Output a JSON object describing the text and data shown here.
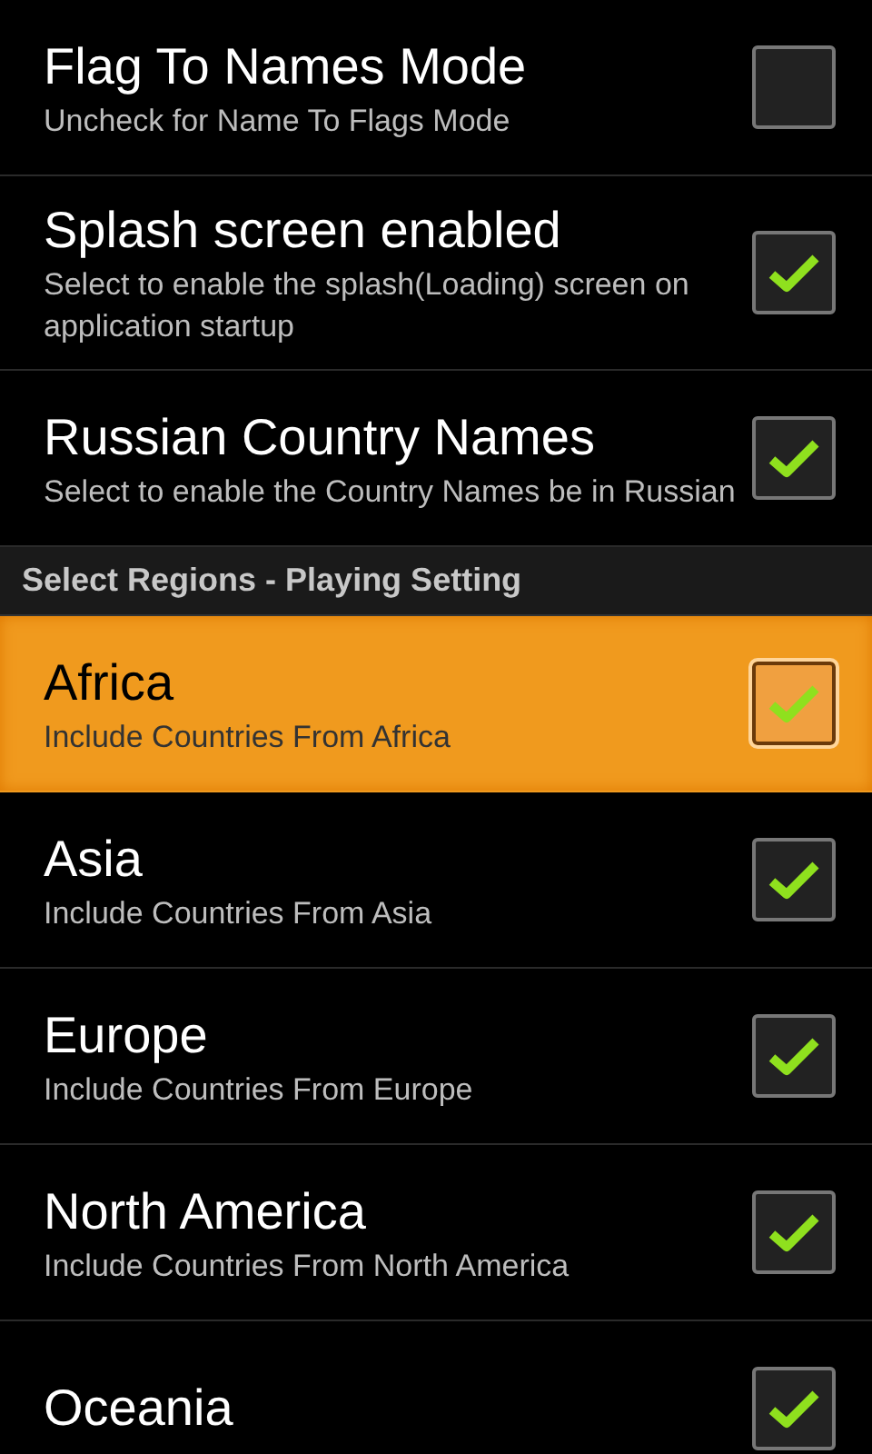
{
  "items": [
    {
      "kind": "pref",
      "title": "Flag To Names Mode",
      "summary": "Uncheck for Name To Flags Mode",
      "checked": false,
      "selected": false
    },
    {
      "kind": "pref",
      "title": "Splash screen enabled",
      "summary": "Select to enable the splash(Loading) screen on application startup",
      "checked": true,
      "selected": false
    },
    {
      "kind": "pref",
      "title": "Russian Country Names",
      "summary": "Select to enable the Country Names be in Russian",
      "checked": true,
      "selected": false
    },
    {
      "kind": "category",
      "title": "Select Regions - Playing Setting"
    },
    {
      "kind": "pref",
      "title": "Africa",
      "summary": "Include Countries From Africa",
      "checked": true,
      "selected": true
    },
    {
      "kind": "pref",
      "title": "Asia",
      "summary": "Include Countries From Asia",
      "checked": true,
      "selected": false
    },
    {
      "kind": "pref",
      "title": "Europe",
      "summary": "Include Countries From Europe",
      "checked": true,
      "selected": false
    },
    {
      "kind": "pref",
      "title": "North America",
      "summary": "Include Countries From North America",
      "checked": true,
      "selected": false
    },
    {
      "kind": "pref",
      "title": "Oceania",
      "checked": true,
      "selected": false
    }
  ]
}
